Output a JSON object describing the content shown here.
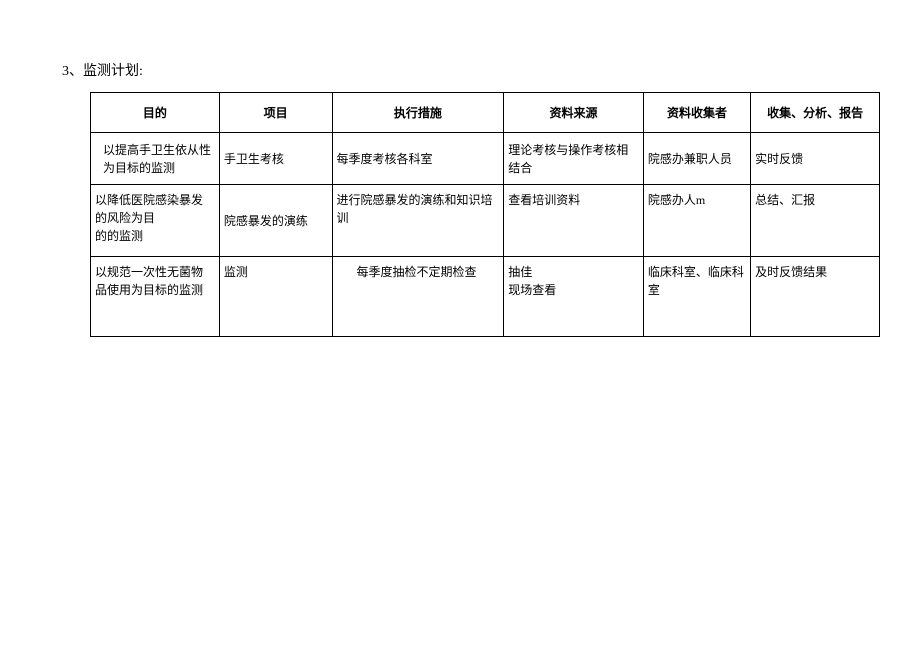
{
  "heading": "3、监测计划:",
  "headers": {
    "purpose": "目的",
    "project": "项目",
    "measure": "执行措施",
    "source": "资料来源",
    "collector": "资料收集者",
    "report": "收集、分析、报告"
  },
  "rows": [
    {
      "purpose": "以提高手卫生依从性为目标的监测",
      "project": "手卫生考核",
      "measure": "每季度考核各科室",
      "source": "理论考核与操作考核相结合",
      "collector": "院感办兼职人员",
      "report": "实时反馈"
    },
    {
      "purpose": "以降低医院感染暴发的风险为目\n的的监测",
      "project": "院感暴发的演练",
      "measure": "进行院感暴发的演练和知识培训",
      "source": "查看培训资料",
      "collector": "院感办人m",
      "report": "总结、汇报"
    },
    {
      "purpose": "以规范一次性无菌物品使用为目标的监测",
      "project": "监测",
      "measure": "每季度抽检不定期检查",
      "source": "抽佳\n现场查看",
      "collector": "临床科室、临床科室",
      "report": "及时反馈结果"
    }
  ]
}
